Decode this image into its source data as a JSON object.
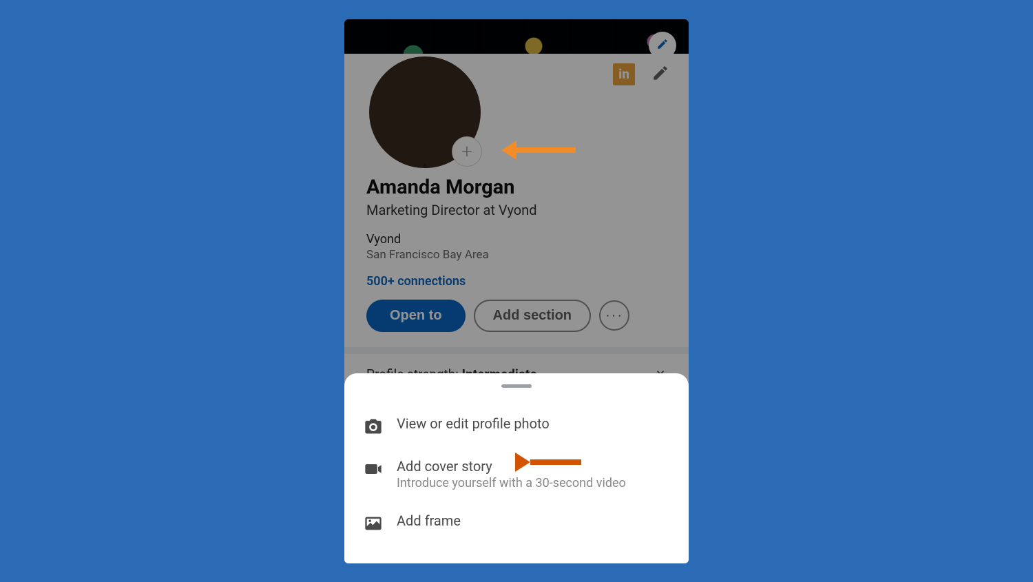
{
  "profile": {
    "name": "Amanda Morgan",
    "headline": "Marketing Director at Vyond",
    "company": "Vyond",
    "location": "San Francisco Bay Area",
    "connections": "500+ connections",
    "open_to_label": "Open to",
    "add_section_label": "Add section",
    "more_label": "···",
    "add_badge": "+"
  },
  "li_logo": "in",
  "strength": {
    "label": "Profile strength: ",
    "value": "Intermediate"
  },
  "sheet": {
    "items": [
      {
        "icon": "camera",
        "title": "View or edit profile photo",
        "subtitle": ""
      },
      {
        "icon": "video",
        "title": "Add cover story",
        "subtitle": "Introduce yourself with a 30-second video"
      },
      {
        "icon": "image",
        "title": "Add frame",
        "subtitle": ""
      }
    ]
  }
}
